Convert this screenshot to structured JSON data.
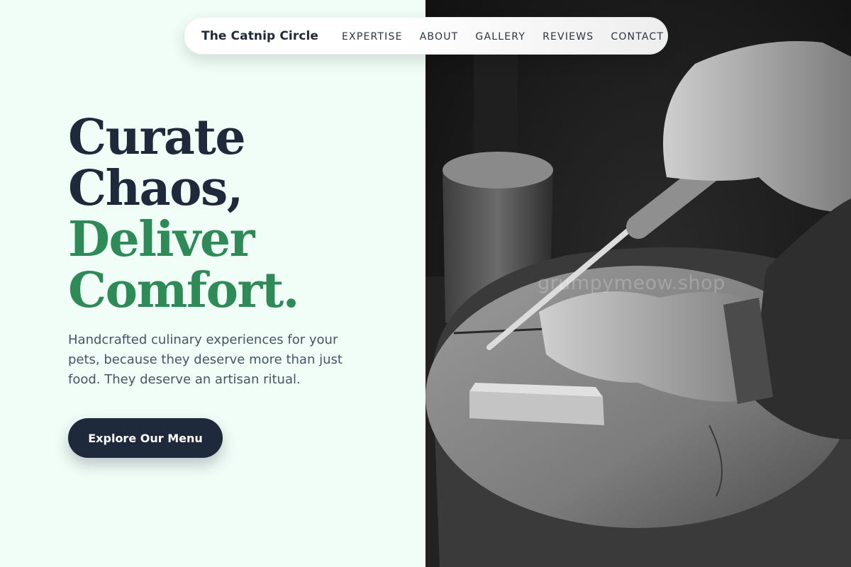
{
  "nav": {
    "brand": "The Catnip Circle",
    "links": [
      "EXPERTISE",
      "ABOUT",
      "GALLERY",
      "REVIEWS",
      "CONTACT"
    ]
  },
  "hero": {
    "headline_line1": "Curate",
    "headline_line2": "Chaos,",
    "headline_line3": "Deliver",
    "headline_line4": "Comfort.",
    "subtitle": "Handcrafted culinary experiences for your pets, because they deserve more than just food. They deserve an artisan ritual.",
    "cta_label": "Explore Our Menu"
  },
  "image": {
    "watermark": "grumpymeow.shop",
    "subject": "black-and-white photo of hands carving wood with a chisel"
  },
  "colors": {
    "left_background": "#f1fdf7",
    "heading_dark": "#1e293b",
    "heading_accent": "#2e8b57",
    "cta_background": "#1e293b"
  }
}
